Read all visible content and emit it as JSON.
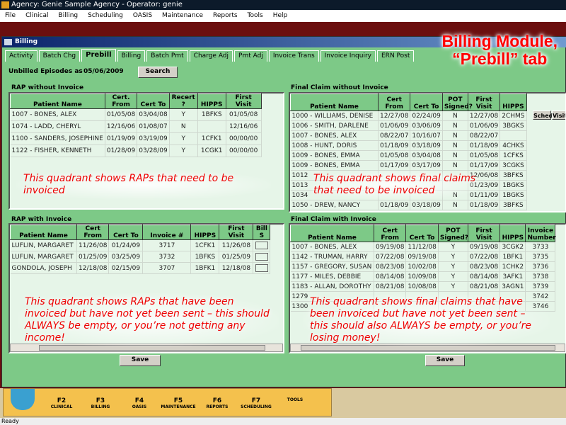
{
  "window_title": "Agency: Genie Sample Agency - Operator: genie",
  "menu": [
    "File",
    "Clinical",
    "Billing",
    "Scheduling",
    "OASIS",
    "Maintenance",
    "Reports",
    "Tools",
    "Help"
  ],
  "billing_window": {
    "title": "Billing"
  },
  "tabs": [
    "Activity",
    "Batch Chg",
    "Prebill",
    "Billing",
    "Batch Pmt",
    "Charge Adj",
    "Pmt Adj",
    "Invoice Trans",
    "Invoice Inquiry",
    "ERN Post"
  ],
  "active_tab": "Prebill",
  "unbilled": {
    "label": "Unbilled Episodes as",
    "date": "05/06/2009",
    "search": "Search"
  },
  "rap_without_invoice": {
    "title": "RAP without Invoice",
    "columns": [
      "Patient Name",
      "Cert. From",
      "Cert To",
      "Recert ?",
      "HIPPS",
      "First Visit"
    ],
    "rows": [
      [
        "1007 - BONES, ALEX",
        "01/05/08",
        "03/04/08",
        "Y",
        "1BFKS",
        "01/05/08"
      ],
      [
        "1074 - LADD, CHERYL",
        "12/16/06",
        "01/08/07",
        "N",
        "",
        "12/16/06"
      ],
      [
        "1100 - SANDERS, JOSEPHINE",
        "01/19/09",
        "03/19/09",
        "Y",
        "1CFK1",
        "00/00/00"
      ],
      [
        "1122 - FISHER, KENNETH",
        "01/28/09",
        "03/28/09",
        "Y",
        "1CGK1",
        "00/00/00"
      ]
    ],
    "note": "This quadrant shows RAPs that need to be invoiced"
  },
  "final_without_invoice": {
    "title": "Final Claim without Invoice",
    "columns": [
      "Patient Name",
      "Cert From",
      "Cert To",
      "POT Signed?",
      "First Visit",
      "HIPPS"
    ],
    "rows": [
      [
        "1000 - WILLIAMS, DENISE",
        "12/27/08",
        "02/24/09",
        "N",
        "12/27/08",
        "2CHMS"
      ],
      [
        "1006 - SMITH, DARLENE",
        "01/06/09",
        "03/06/09",
        "N",
        "01/06/09",
        "3BGKS"
      ],
      [
        "1007 - BONES, ALEX",
        "08/22/07",
        "10/16/07",
        "N",
        "08/22/07",
        ""
      ],
      [
        "1008 - HUNT, DORIS",
        "01/18/09",
        "03/18/09",
        "N",
        "01/18/09",
        "4CHKS"
      ],
      [
        "1009 - BONES, EMMA",
        "01/05/08",
        "03/04/08",
        "N",
        "01/05/08",
        "1CFKS"
      ],
      [
        "1009 - BONES, EMMA",
        "01/17/09",
        "03/17/09",
        "N",
        "01/17/09",
        "3CGKS"
      ],
      [
        "1012",
        "",
        "",
        "",
        "12/06/08",
        "3BFKS"
      ],
      [
        "1013",
        "",
        "",
        "",
        "01/23/09",
        "1BGKS"
      ],
      [
        "1034",
        "",
        "",
        "N",
        "01/11/09",
        "1BGKS"
      ],
      [
        "1050 - DREW, NANCY",
        "01/18/09",
        "03/18/09",
        "N",
        "01/18/09",
        "3BFKS"
      ]
    ],
    "sched": "Sched",
    "visits": "Visits",
    "note": "This quadrant shows final claims that need to be invoiced"
  },
  "rap_with_invoice": {
    "title": "RAP with Invoice",
    "columns": [
      "Patient Name",
      "Cert From",
      "Cert To",
      "Invoice #",
      "HIPPS",
      "First Visit",
      "Bill S"
    ],
    "rows": [
      [
        "LUFLIN, MARGARET",
        "11/26/08",
        "01/24/09",
        "3717",
        "1CFK1",
        "11/26/08"
      ],
      [
        "LUFLIN, MARGARET",
        "01/25/09",
        "03/25/09",
        "3732",
        "1BFKS",
        "01/25/09"
      ],
      [
        "GONDOLA, JOSEPH",
        "12/18/08",
        "02/15/09",
        "3707",
        "1BFK1",
        "12/18/08"
      ]
    ],
    "note": "This quadrant shows RAPs that have been invoiced but have not yet been sent – this should ALWAYS be empty, or you’re not getting any income!",
    "save": "Save"
  },
  "final_with_invoice": {
    "title": "Final Claim with Invoice",
    "columns": [
      "Patient Name",
      "Cert From",
      "Cert To",
      "POT Signed?",
      "First Visit",
      "HIPPS",
      "Invoice Number"
    ],
    "rows": [
      [
        "1007 - BONES, ALEX",
        "09/19/08",
        "11/12/08",
        "Y",
        "09/19/08",
        "3CGK2",
        "3733"
      ],
      [
        "1142 - TRUMAN, HARRY",
        "07/22/08",
        "09/19/08",
        "Y",
        "07/22/08",
        "1BFK1",
        "3735"
      ],
      [
        "1157 - GREGORY, SUSAN",
        "08/23/08",
        "10/02/08",
        "Y",
        "08/23/08",
        "1CHK2",
        "3736"
      ],
      [
        "1177 - MILES, DEBBIE",
        "08/14/08",
        "10/09/08",
        "Y",
        "08/14/08",
        "3AFK1",
        "3738"
      ],
      [
        "1183 - ALLAN, DOROTHY",
        "08/21/08",
        "10/08/08",
        "Y",
        "08/21/08",
        "3AGN1",
        "3739"
      ],
      [
        "1279",
        "",
        "",
        "",
        "",
        "",
        "3742"
      ],
      [
        "1300",
        "",
        "",
        "",
        "",
        "",
        "3746"
      ]
    ],
    "note": "This quadrant shows final claims that have been invoiced but have not yet been sent – this should also ALWAYS be empty, or you’re losing money!",
    "save": "Save"
  },
  "callout": {
    "line1": "Billing Module,",
    "line2": "“Prebill” tab"
  },
  "toolbar": [
    {
      "key": "F2",
      "label": "CLINICAL"
    },
    {
      "key": "F3",
      "label": "BILLING"
    },
    {
      "key": "F4",
      "label": "OASIS"
    },
    {
      "key": "F5",
      "label": "MAINTENANCE"
    },
    {
      "key": "F6",
      "label": "REPORTS"
    },
    {
      "key": "F7",
      "label": "SCHEDULING"
    },
    {
      "key": "",
      "label": "TOOLS"
    }
  ],
  "status": "Ready"
}
